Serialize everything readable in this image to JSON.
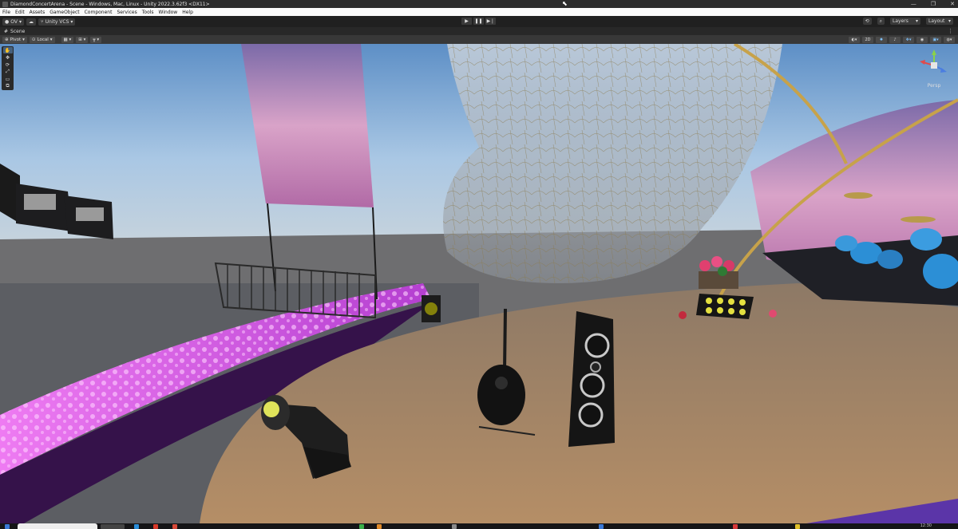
{
  "window": {
    "title": "DiamondConcertArena - Scene - Windows, Mac, Linux - Unity 2022.3.62f3 <DX11>",
    "controls": [
      "—",
      "❐",
      "✕"
    ]
  },
  "menu": [
    "File",
    "Edit",
    "Assets",
    "GameObject",
    "Component",
    "Services",
    "Tools",
    "Window",
    "Help"
  ],
  "toolbar": {
    "account_label": "OV",
    "vcs_label": "Unity VCS",
    "play_buttons": [
      "▶",
      "❚❚",
      "▶❘"
    ],
    "history_icon": "history-icon",
    "search_icon": "search-icon",
    "layers_label": "Layers",
    "layout_label": "Layout"
  },
  "scene_tab": {
    "label": "Scene",
    "menu_dots": "⋮"
  },
  "scene_toolbar": {
    "pivot_label": "Pivot",
    "space_label": "Local",
    "mode_2d_label": "2D"
  },
  "tools": [
    "✋",
    "✥",
    "⟳",
    "⤢",
    "▭",
    "⧉"
  ],
  "gizmo": {
    "view_label": "Persp"
  },
  "colors": {
    "accent_selected": "#46607c",
    "sky": "#9fc3e6",
    "ground": "#70747a",
    "desert": "#a9865f",
    "magenta_floor": "#d34fe0",
    "purple_carpet": "#39154f"
  },
  "taskbar": {
    "clock": "12:30"
  }
}
